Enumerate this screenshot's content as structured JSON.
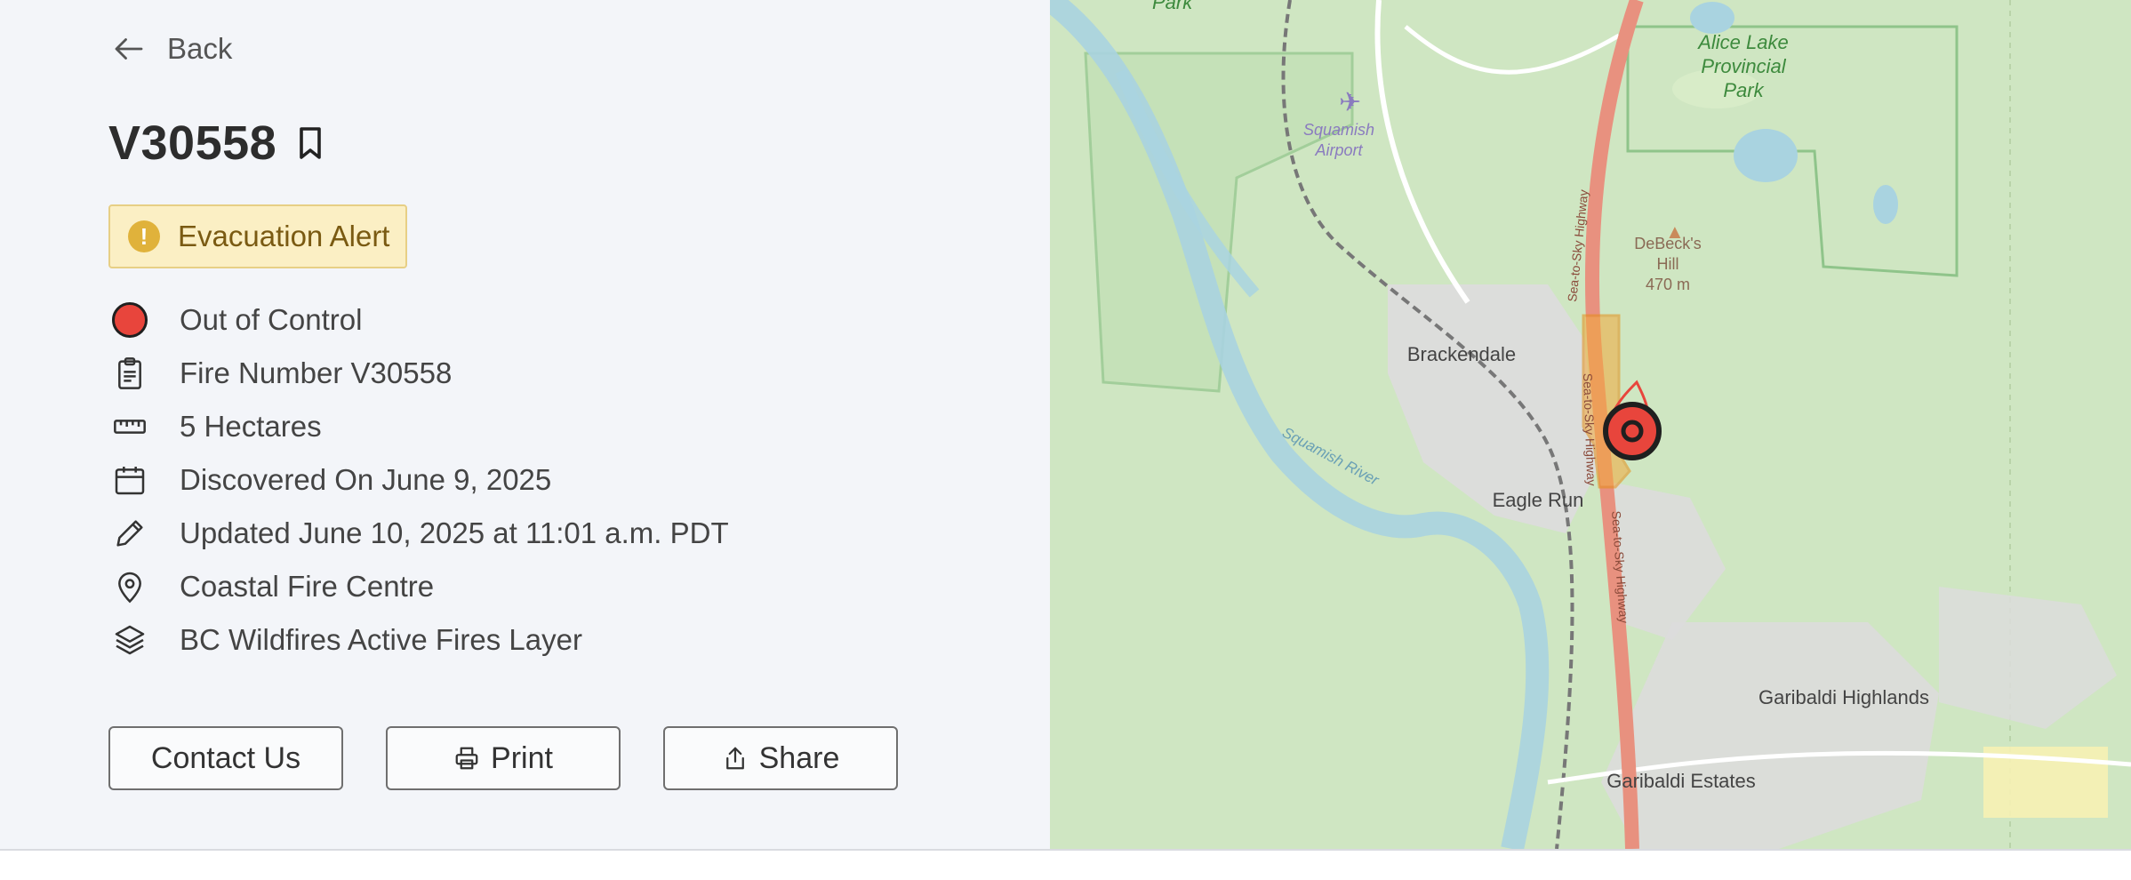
{
  "nav": {
    "back_label": "Back"
  },
  "incident": {
    "id": "V30558",
    "alert_label": "Evacuation Alert",
    "status": "Out of Control",
    "fire_number": "Fire Number V30558",
    "size": "5 Hectares",
    "discovered": "Discovered On June 9, 2025",
    "updated": "Updated June 10, 2025 at 11:01 a.m. PDT",
    "centre": "Coastal Fire Centre",
    "layer": "BC Wildfires Active Fires Layer"
  },
  "actions": {
    "contact_label": "Contact Us",
    "print_label": "Print",
    "share_label": "Share"
  },
  "map": {
    "labels": {
      "park_top": "Park",
      "alice_lake_1": "Alice Lake",
      "alice_lake_2": "Provincial",
      "alice_lake_3": "Park",
      "airport_1": "Squamish",
      "airport_2": "Airport",
      "debeck_1": "DeBeck's",
      "debeck_2": "Hill",
      "debeck_3": "470 m",
      "brackendale": "Brackendale",
      "eagle_run": "Eagle Run",
      "squamish_river": "Squamish River",
      "highway_1": "Sea-to-Sky Highway",
      "highway_2": "Sea-to-Sky Highway",
      "highway_3": "Sea-to-Sky Highway",
      "garibaldi_highlands": "Garibaldi Highlands",
      "garibaldi_estates": "Garibaldi Estates"
    },
    "colors": {
      "forest": "#cfe6c2",
      "river": "#a9d3e0",
      "highway": "#e8917f",
      "urban": "#dcdcdc",
      "evac_zone": "#f2a93b",
      "fire_marker": "#e8453c"
    }
  },
  "icons": {
    "back": "arrow-left-icon",
    "bookmark": "bookmark-icon",
    "alert": "exclamation-circle-icon",
    "clipboard": "clipboard-icon",
    "ruler": "ruler-icon",
    "calendar": "calendar-icon",
    "pencil": "pencil-icon",
    "pin": "map-pin-icon",
    "layers": "layers-icon",
    "printer": "printer-icon",
    "share": "share-icon"
  }
}
